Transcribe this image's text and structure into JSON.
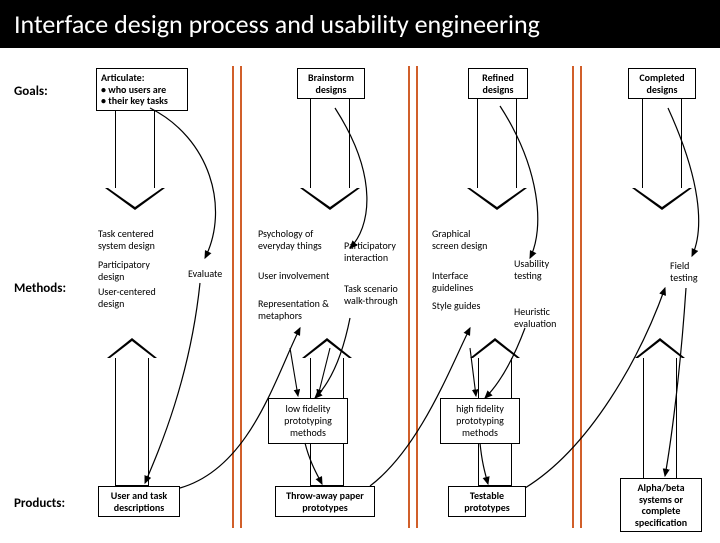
{
  "title": "Interface design process and usability engineering",
  "rows": {
    "goals": "Goals:",
    "methods": "Methods:",
    "products": "Products:"
  },
  "goals": {
    "articulate": "Articulate:\n• who users are\n• their key tasks",
    "brainstorm": "Brainstorm\ndesigns",
    "refined": "Refined\ndesigns",
    "completed": "Completed\ndesigns"
  },
  "methods": {
    "col1_a": "Task centered system design",
    "col1_b": "Participatory design",
    "col1_c": "User-centered design",
    "evaluate": "Evaluate",
    "col2_a": "Psychology of everyday things",
    "col2_b": "User involvement",
    "col2_c": "Representation & metaphors",
    "col3_a": "Participatory interaction",
    "col3_b": "Task scenario walk-through",
    "col4_a": "Graphical screen design",
    "col4_b": "Interface guidelines",
    "col4_c": "Style guides",
    "col5_a": "Usability testing",
    "col5_b": "Heuristic evaluation",
    "col6": "Field testing"
  },
  "between": {
    "lowfi": "low fidelity prototyping methods",
    "hifi": "high fidelity prototyping methods"
  },
  "products": {
    "p1": "User and task descriptions",
    "p2": "Throw-away paper prototypes",
    "p3": "Testable prototypes",
    "p4": "Alpha/beta systems or complete specification"
  }
}
